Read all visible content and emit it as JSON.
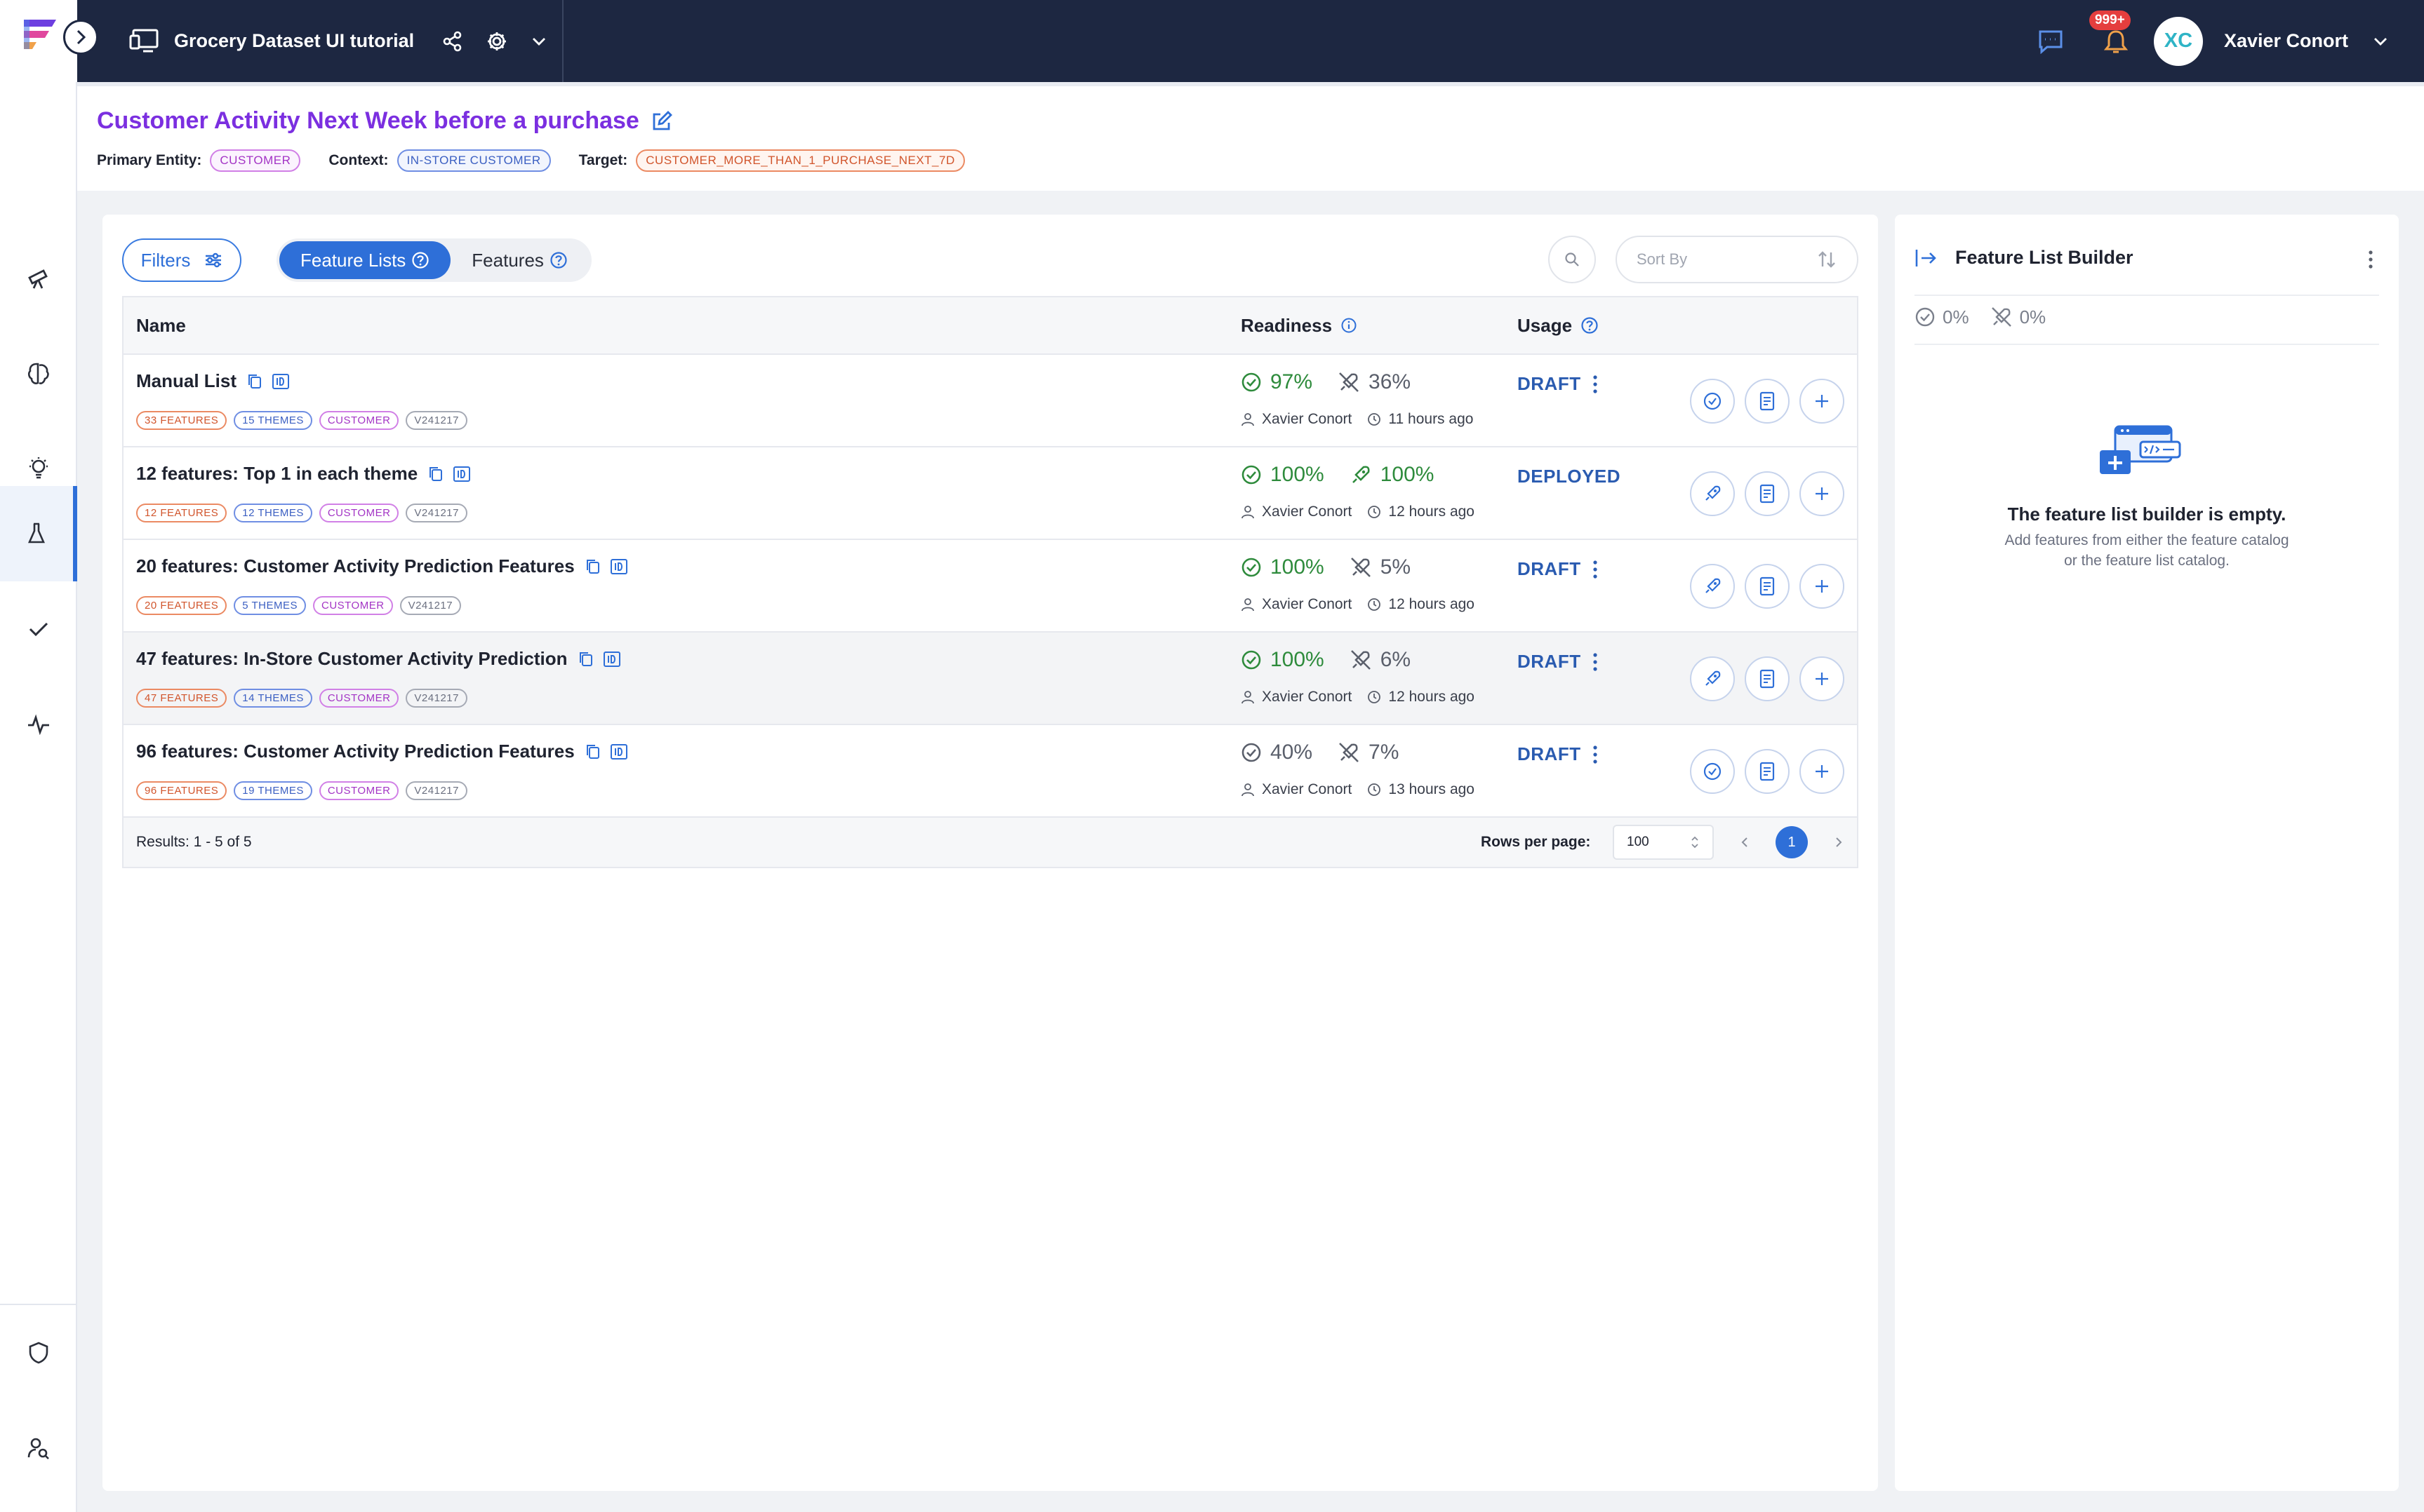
{
  "app": {
    "catalog_name": "Grocery Dataset UI tutorial",
    "notifications_badge": "999+",
    "user_initials": "XC",
    "user_name": "Xavier Conort"
  },
  "header": {
    "title": "Customer Activity Next Week before a purchase",
    "primary_entity_label": "Primary Entity:",
    "primary_entity": "CUSTOMER",
    "context_label": "Context:",
    "context": "IN-STORE CUSTOMER",
    "target_label": "Target:",
    "target": "CUSTOMER_MORE_THAN_1_PURCHASE_NEXT_7D"
  },
  "toolbar": {
    "filters_label": "Filters",
    "tab_feature_lists": "Feature Lists",
    "tab_features": "Features",
    "sort_placeholder": "Sort By"
  },
  "table": {
    "columns": {
      "name": "Name",
      "readiness": "Readiness",
      "usage": "Usage"
    },
    "rows": [
      {
        "name": "Manual List",
        "features": "33 FEATURES",
        "themes": "15 THEMES",
        "entity": "CUSTOMER",
        "version": "V241217",
        "readiness": "97%",
        "online": "36%",
        "owner": "Xavier Conort",
        "time": "11 hours ago",
        "status": "DRAFT"
      },
      {
        "name": "12 features: Top 1 in each theme",
        "features": "12 FEATURES",
        "themes": "12 THEMES",
        "entity": "CUSTOMER",
        "version": "V241217",
        "readiness": "100%",
        "online": "100%",
        "owner": "Xavier Conort",
        "time": "12 hours ago",
        "status": "DEPLOYED"
      },
      {
        "name": "20 features: Customer Activity Prediction Features",
        "features": "20 FEATURES",
        "themes": "5 THEMES",
        "entity": "CUSTOMER",
        "version": "V241217",
        "readiness": "100%",
        "online": "5%",
        "owner": "Xavier Conort",
        "time": "12 hours ago",
        "status": "DRAFT"
      },
      {
        "name": "47 features: In-Store Customer Activity Prediction",
        "features": "47 FEATURES",
        "themes": "14 THEMES",
        "entity": "CUSTOMER",
        "version": "V241217",
        "readiness": "100%",
        "online": "6%",
        "owner": "Xavier Conort",
        "time": "12 hours ago",
        "status": "DRAFT"
      },
      {
        "name": "96 features: Customer Activity Prediction Features",
        "features": "96 FEATURES",
        "themes": "19 THEMES",
        "entity": "CUSTOMER",
        "version": "V241217",
        "readiness": "40%",
        "online": "7%",
        "owner": "Xavier Conort",
        "time": "13 hours ago",
        "status": "DRAFT"
      }
    ],
    "footer": {
      "results": "Results: 1 - 5 of 5",
      "rows_per_page_label": "Rows per page:",
      "rows_per_page": "100",
      "current_page": "1"
    }
  },
  "builder": {
    "title": "Feature List Builder",
    "readiness": "0%",
    "online": "0%",
    "empty_title": "The feature list builder is empty.",
    "empty_line1": "Add features from either the feature catalog",
    "empty_line2": "or the feature list catalog."
  },
  "colors": {
    "topbar": "#1d2741",
    "accent_blue": "#2e6fd8",
    "title_purple": "#7b2fe0",
    "ready_green": "#2e8b3c",
    "status_blue": "#2a5bb0"
  }
}
